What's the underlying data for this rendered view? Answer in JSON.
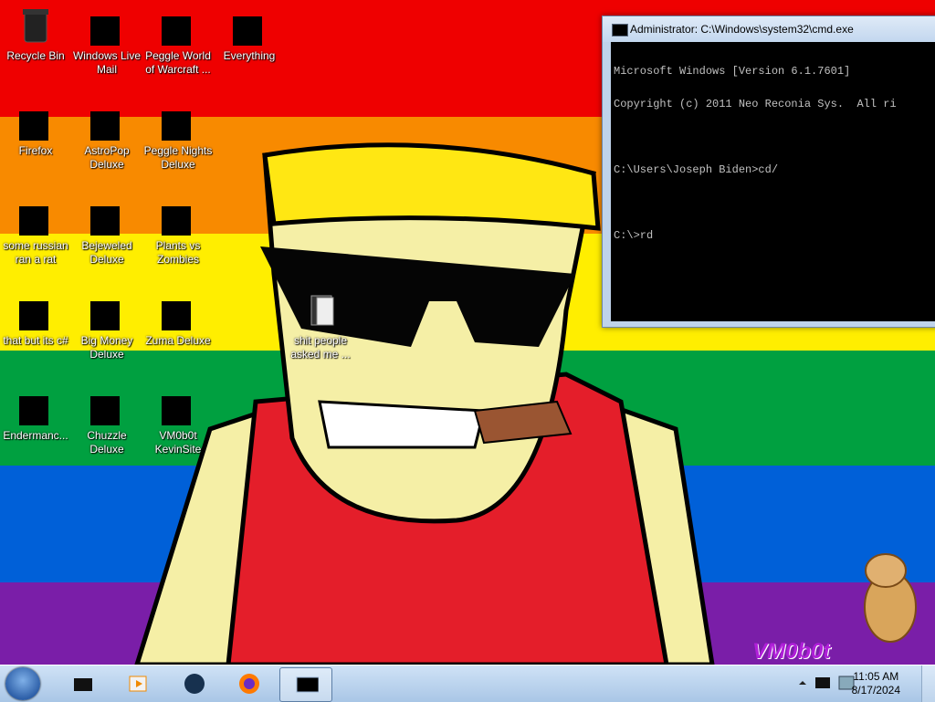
{
  "colors": {
    "rainbow": [
      "#ef0000",
      "#f88a00",
      "#ffee00",
      "#00a040",
      "#0060d8",
      "#7a1ea8"
    ],
    "cmd_bg": "#000000",
    "cmd_fg": "#c0c0c0",
    "taskbar": "#b8d1ee"
  },
  "desktop": {
    "icons": [
      {
        "label": "Recycle Bin",
        "icon": "recycle-bin-icon"
      },
      {
        "label": "Windows Live Mail",
        "icon": "mail-icon"
      },
      {
        "label": "Peggle World of Warcraft ...",
        "icon": "peggle-wow-icon"
      },
      {
        "label": "Everything",
        "icon": "everything-search-icon"
      },
      {
        "label": "Firefox",
        "icon": "firefox-icon"
      },
      {
        "label": "AstroPop Deluxe",
        "icon": "astropop-icon"
      },
      {
        "label": "Peggle Nights Deluxe",
        "icon": "peggle-nights-icon"
      },
      {
        "label": "some russian ran a rat",
        "icon": "executable-icon"
      },
      {
        "label": "Bejeweled Deluxe",
        "icon": "bejeweled-icon"
      },
      {
        "label": "Plants vs Zombies",
        "icon": "pvz-icon"
      },
      {
        "label": "that but its c#",
        "icon": "document-stack-icon"
      },
      {
        "label": "Big Money Deluxe",
        "icon": "money-bag-icon"
      },
      {
        "label": "Zuma Deluxe",
        "icon": "zuma-icon"
      },
      {
        "label": "Endermanc...",
        "icon": "terminal-app-icon"
      },
      {
        "label": "Chuzzle Deluxe",
        "icon": "chuzzle-icon"
      },
      {
        "label": "VM0b0t KevinSite",
        "icon": "website-icon"
      },
      {
        "label": "shit people asked me ...",
        "icon": "folder-icon"
      }
    ]
  },
  "cmd": {
    "title": "Administrator: C:\\Windows\\system32\\cmd.exe",
    "lines": [
      "Microsoft Windows [Version 6.1.7601]",
      "Copyright (c) 2011 Neo Reconia Sys.  All ri",
      "",
      "C:\\Users\\Joseph Biden>cd/",
      "",
      "C:\\>rd"
    ]
  },
  "taskbar": {
    "start_icon": "windows-orb-icon",
    "pinned": [
      {
        "name": "dark-box-app-icon"
      },
      {
        "name": "media-player-icon"
      },
      {
        "name": "globe-browser-icon"
      },
      {
        "name": "firefox-taskbar-icon"
      },
      {
        "name": "cmd-taskbar-icon",
        "active": true
      }
    ],
    "clock": {
      "time": "11:05 AM",
      "date": "8/17/2024"
    }
  },
  "watermark": "VM0b0t"
}
